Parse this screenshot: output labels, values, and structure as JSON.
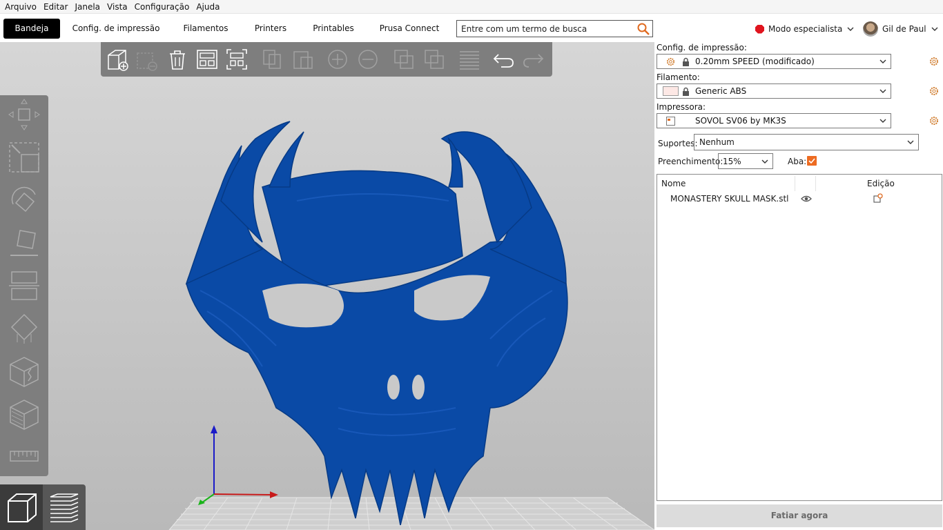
{
  "menu": [
    "Arquivo",
    "Editar",
    "Janela",
    "Vista",
    "Configuração",
    "Ajuda"
  ],
  "tabs": {
    "plater": "Bandeja",
    "print_settings": "Config. de impressão",
    "filaments": "Filamentos",
    "printers": "Printers",
    "printables": "Printables",
    "prusa_connect": "Prusa Connect"
  },
  "search": {
    "placeholder": "Entre com um termo de busca"
  },
  "mode": {
    "label": "Modo especialista",
    "color": "#e0141e"
  },
  "user": {
    "name": "Gil de Paul"
  },
  "panel": {
    "print_label": "Config. de impressão:",
    "print_value": "0.20mm SPEED (modificado)",
    "filament_label": "Filamento:",
    "filament_value": "Generic ABS",
    "filament_color": "#fde8e5",
    "printer_label": "Impressora:",
    "printer_value": "SOVOL SV06 by MK3S",
    "supports_label": "Suportes:",
    "supports_value": "Nenhum",
    "infill_label": "Preenchimento:",
    "infill_value": "15%",
    "brim_label": "Aba:",
    "brim_checked": true,
    "accent": "#ed6b21"
  },
  "object_list": {
    "col_name": "Nome",
    "col_edit": "Edição",
    "objects": [
      {
        "name": "MONASTERY SKULL MASK.stl",
        "visible": true
      }
    ]
  },
  "slice_button": "Fatiar agora",
  "model": {
    "color": "#0a4aa6"
  }
}
